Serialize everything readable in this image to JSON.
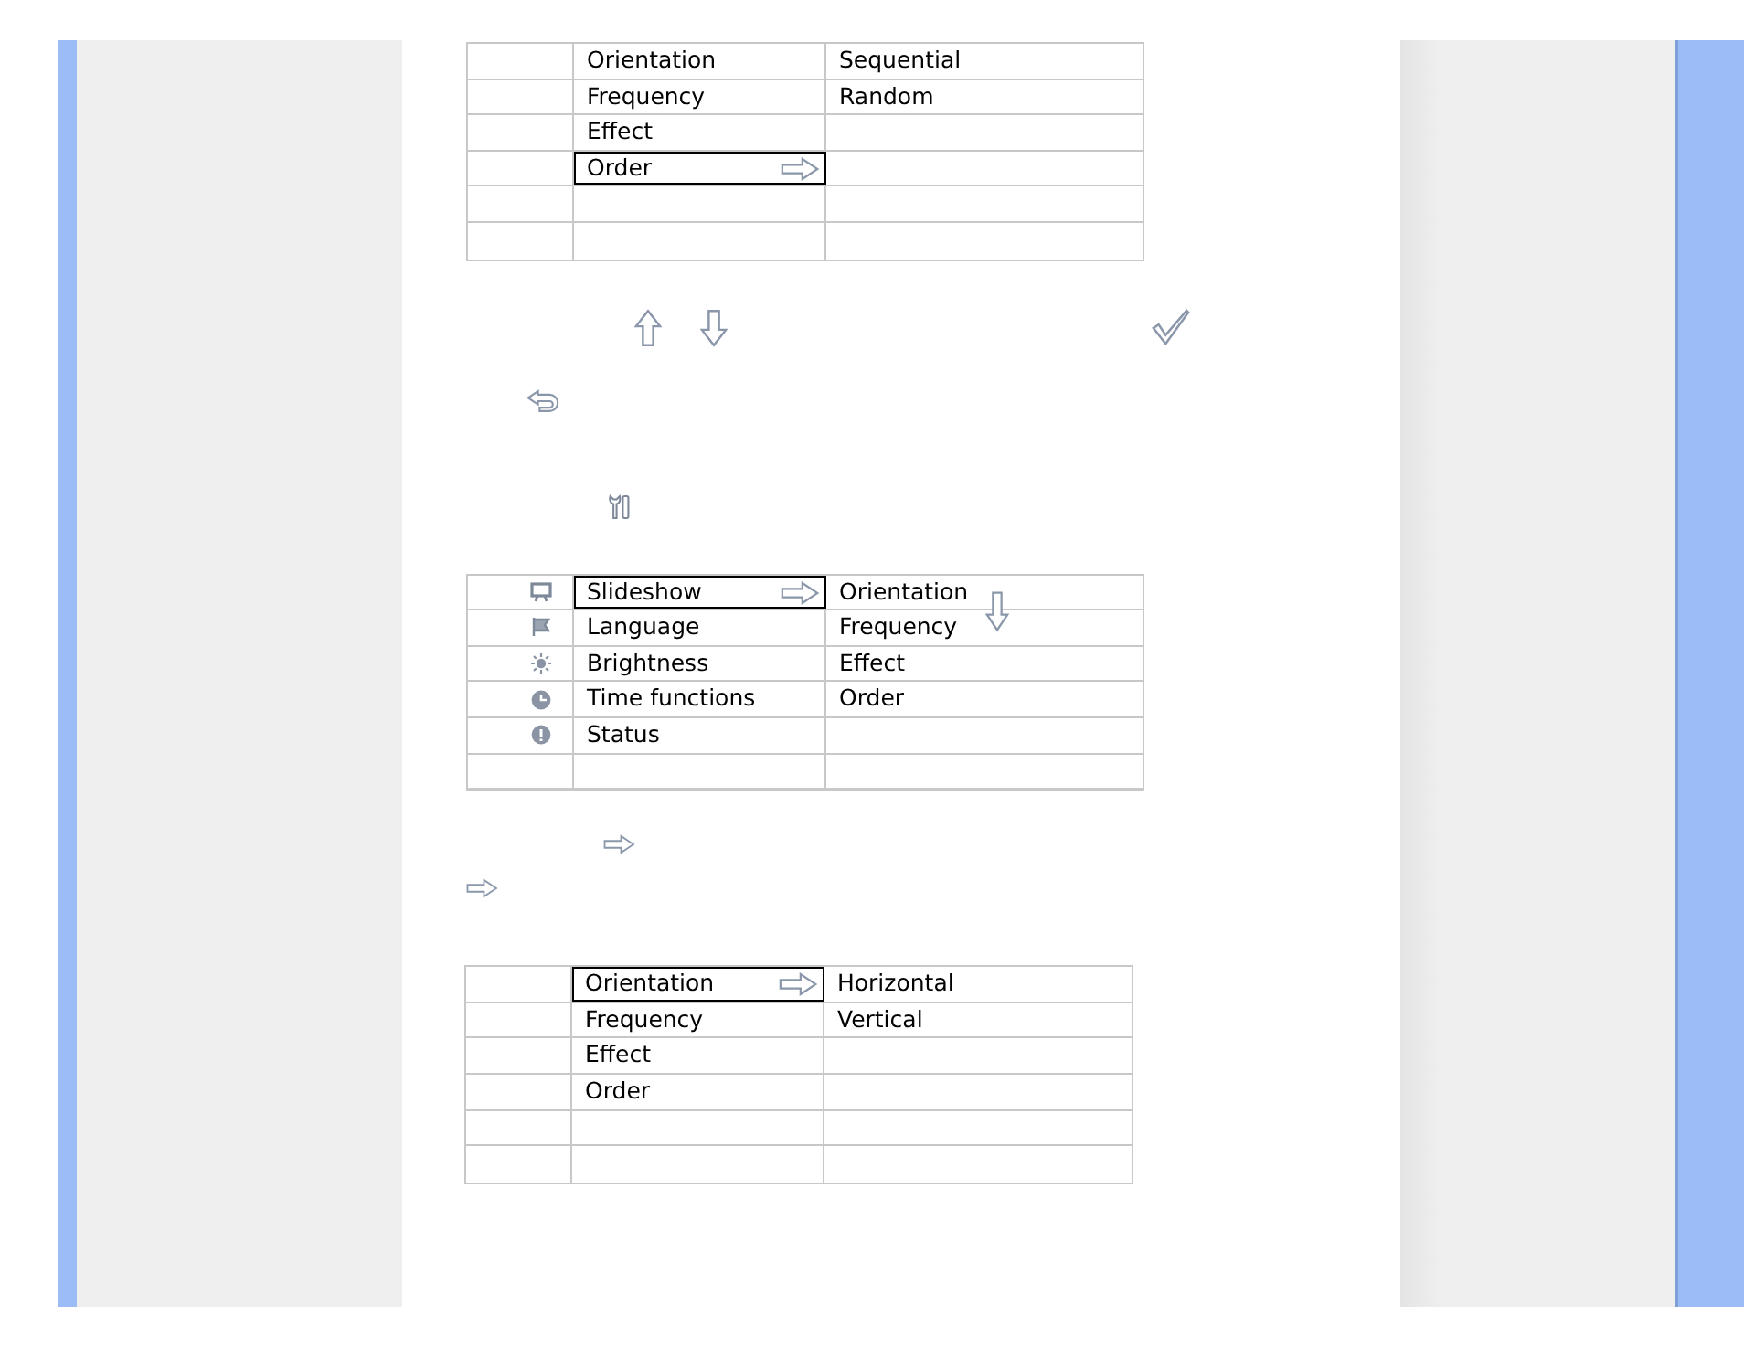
{
  "tables": [
    {
      "rows": [
        {
          "label": "Orientation",
          "value": "Sequential",
          "selected": false
        },
        {
          "label": "Frequency",
          "value": "Random",
          "selected": false
        },
        {
          "label": "Effect",
          "selected": false
        },
        {
          "label": "Order",
          "selected": true
        },
        {
          "selected": false
        },
        {
          "selected": false
        }
      ]
    },
    {
      "rows": [
        {
          "label": "Slideshow",
          "value": "Orientation",
          "selected": true
        },
        {
          "label": "Language",
          "value": "Frequency",
          "selected": false
        },
        {
          "label": "Brightness",
          "value": "Effect",
          "selected": false
        },
        {
          "label": "Time functions",
          "value": "Order",
          "selected": false
        },
        {
          "label": "Status",
          "selected": false
        },
        {
          "selected": false
        }
      ]
    },
    {
      "rows": [
        {
          "label": "Orientation",
          "value": "Horizontal",
          "selected": true
        },
        {
          "label": "Frequency",
          "value": "Vertical",
          "selected": false
        },
        {
          "label": "Effect",
          "selected": false
        },
        {
          "label": "Order",
          "selected": false
        },
        {
          "selected": false
        },
        {
          "selected": false
        }
      ]
    }
  ]
}
